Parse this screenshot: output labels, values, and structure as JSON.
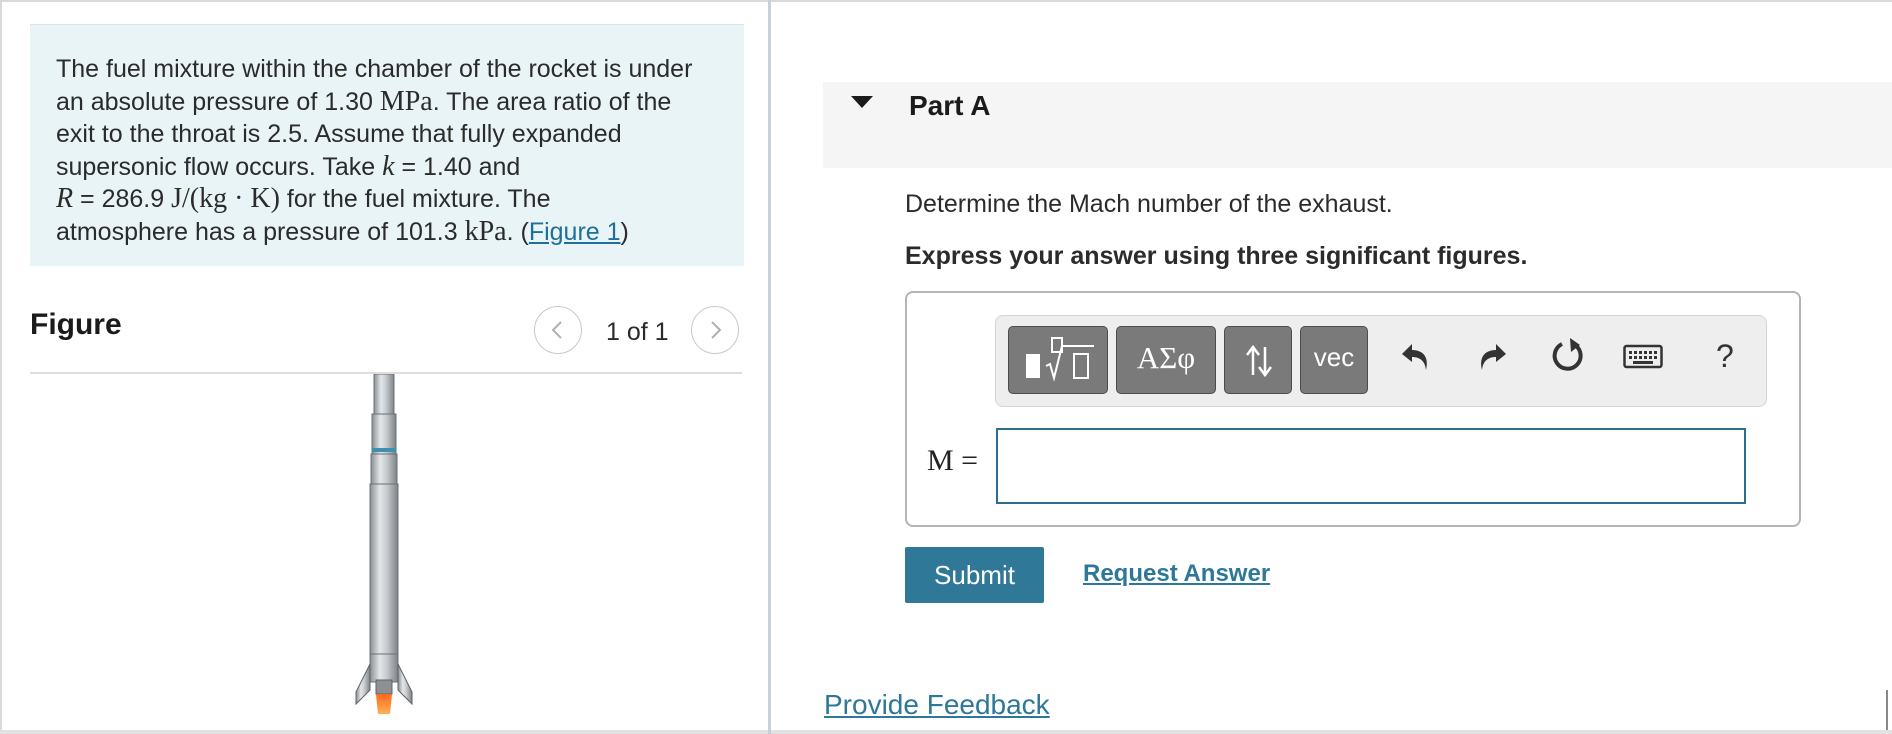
{
  "problem": {
    "line1": "The fuel mixture within the chamber of the rocket is under",
    "line2_pre": "an absolute pressure of 1.30 ",
    "line2_unit": "MPa",
    "line2_post": ". The area ratio of the",
    "line3": "exit to the throat is 2.5. Assume that fully expanded",
    "line4_pre": "supersonic flow occurs. Take ",
    "line4_var": "k",
    "line4_post": " = 1.40 and",
    "line5_var": "R",
    "line5_mid": " = 286.9 ",
    "line5_unit": "J/(kg · K)",
    "line5_post": " for the fuel mixture. The",
    "line6_pre": "atmosphere has a pressure of 101.3 ",
    "line6_unit": "kPa",
    "line6_mid": ". (",
    "figure_link": "Figure 1",
    "line6_end": ")"
  },
  "figure": {
    "heading": "Figure",
    "pager_count": "1 of 1"
  },
  "part": {
    "title": "Part A",
    "question": "Determine the Mach number of the exhaust.",
    "instruction": "Express your answer using three significant figures."
  },
  "toolbar": {
    "greek_label": "ΑΣφ",
    "vec_label": "vec",
    "help_label": "?",
    "icons": [
      "templates-icon",
      "greek-letters-icon",
      "arrows-icon",
      "vector-icon",
      "undo-icon",
      "redo-icon",
      "reset-icon",
      "keyboard-icon",
      "help-icon"
    ]
  },
  "answer": {
    "label": "M =",
    "value": ""
  },
  "actions": {
    "submit": "Submit",
    "request": "Request Answer",
    "feedback": "Provide Feedback"
  },
  "colors": {
    "accent": "#2f7898",
    "problem_bg": "#e8f4f6",
    "toolbar_button": "#7a7a7a",
    "input_border": "#2c6f8b"
  }
}
